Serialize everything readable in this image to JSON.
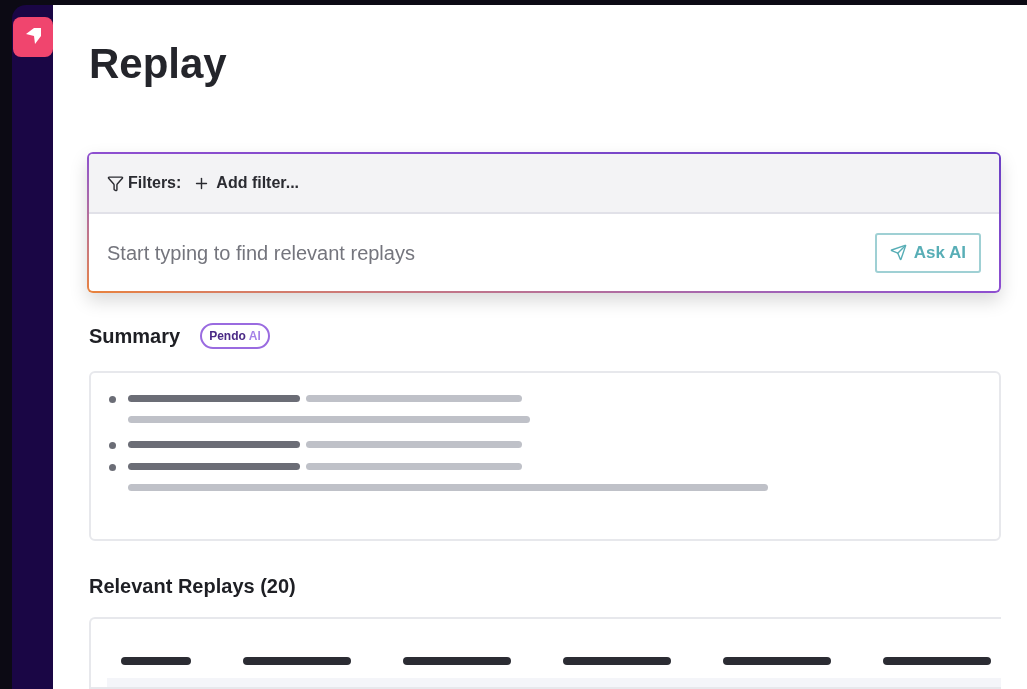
{
  "page": {
    "title": "Replay"
  },
  "filters": {
    "label": "Filters:",
    "add_button": "Add filter...",
    "search": {
      "placeholder": "Start typing to find relevant replays"
    },
    "ask_button": "Ask AI"
  },
  "summary": {
    "title": "Summary",
    "badge": {
      "brand": "Pendo",
      "suffix": "AI"
    }
  },
  "replays": {
    "title": "Relevant Replays (20)"
  }
}
